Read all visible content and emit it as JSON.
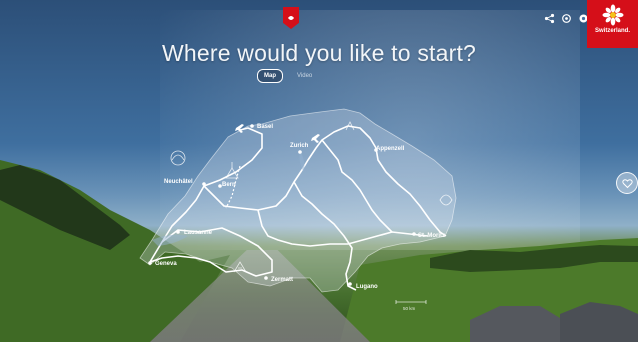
{
  "header": {
    "headline": "Where would you like to start?",
    "brand_name": "Switzerland.",
    "top_icons": [
      "share-icon",
      "settings-icon",
      "menu-icon"
    ]
  },
  "tabs": [
    {
      "label": "Map",
      "active": true
    },
    {
      "label": "Video",
      "active": false
    }
  ],
  "map": {
    "cities": [
      {
        "name": "Basel"
      },
      {
        "name": "Zurich"
      },
      {
        "name": "Appenzell"
      },
      {
        "name": "Neuchâtel"
      },
      {
        "name": "Bern"
      },
      {
        "name": "Lausanne"
      },
      {
        "name": "Geneva"
      },
      {
        "name": "Zermatt"
      },
      {
        "name": "Lugano"
      },
      {
        "name": "St. Moritz"
      }
    ],
    "scale_label": "50 km"
  },
  "colors": {
    "brand_red": "#d50f19",
    "route": "#ffffff"
  },
  "side_button": {
    "icon": "heart-icon"
  }
}
